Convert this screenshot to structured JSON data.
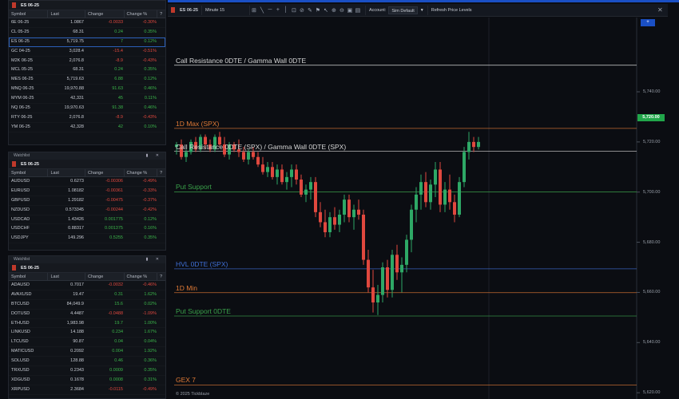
{
  "watchlist1": {
    "symbol": "ES 06-25",
    "headers": [
      "Symbol",
      "Last",
      "Change",
      "Change %"
    ],
    "rows": [
      {
        "sym": "6E 06-25",
        "last": "1.0867",
        "chg": "-0.0033",
        "pct": "-0.30%",
        "dir": "neg"
      },
      {
        "sym": "CL 05-25",
        "last": "68.31",
        "chg": "0.24",
        "pct": "0.35%",
        "dir": "pos"
      },
      {
        "sym": "ES 06-25",
        "last": "5,719.75",
        "chg": "7",
        "pct": "0.12%",
        "dir": "pos"
      },
      {
        "sym": "GC 04-25",
        "last": "3,028.4",
        "chg": "-15.4",
        "pct": "-0.51%",
        "dir": "neg"
      },
      {
        "sym": "M2K 06-25",
        "last": "2,076.8",
        "chg": "-8.9",
        "pct": "-0.43%",
        "dir": "neg"
      },
      {
        "sym": "MCL 05-25",
        "last": "68.31",
        "chg": "0.24",
        "pct": "0.35%",
        "dir": "pos"
      },
      {
        "sym": "MES 06-25",
        "last": "5,719.63",
        "chg": "6.88",
        "pct": "0.12%",
        "dir": "pos"
      },
      {
        "sym": "MNQ 06-25",
        "last": "19,970.88",
        "chg": "91.63",
        "pct": "0.46%",
        "dir": "pos"
      },
      {
        "sym": "MYM 06-25",
        "last": "42,331",
        "chg": "45",
        "pct": "0.11%",
        "dir": "pos"
      },
      {
        "sym": "NQ 06-25",
        "last": "19,970.63",
        "chg": "91.38",
        "pct": "0.46%",
        "dir": "pos"
      },
      {
        "sym": "RTY 06-25",
        "last": "2,076.8",
        "chg": "-8.9",
        "pct": "-0.43%",
        "dir": "neg"
      },
      {
        "sym": "YM 06-25",
        "last": "42,328",
        "chg": "42",
        "pct": "0.10%",
        "dir": "pos"
      }
    ]
  },
  "watchlist2": {
    "title": "Watchlist",
    "symbol": "ES 06-25",
    "headers": [
      "Symbol",
      "Last",
      "Change",
      "Change %"
    ],
    "rows": [
      {
        "sym": "AUDUSD",
        "last": "0.6273",
        "chg": "-0.00306",
        "pct": "-0.49%",
        "dir": "neg"
      },
      {
        "sym": "EURUSD",
        "last": "1.08182",
        "chg": "-0.00361",
        "pct": "-0.33%",
        "dir": "neg"
      },
      {
        "sym": "GBPUSD",
        "last": "1.29182",
        "chg": "-0.00475",
        "pct": "-0.37%",
        "dir": "neg"
      },
      {
        "sym": "NZDUSD",
        "last": "0.573345",
        "chg": "-0.00244",
        "pct": "-0.42%",
        "dir": "neg"
      },
      {
        "sym": "USDCAD",
        "last": "1.43426",
        "chg": "0.001775",
        "pct": "0.12%",
        "dir": "pos"
      },
      {
        "sym": "USDCHF",
        "last": "0.88317",
        "chg": "0.001375",
        "pct": "0.16%",
        "dir": "pos"
      },
      {
        "sym": "USDJPY",
        "last": "149.296",
        "chg": "0.5255",
        "pct": "0.35%",
        "dir": "pos"
      }
    ]
  },
  "watchlist3": {
    "title": "Watchlist",
    "symbol": "ES 06-25",
    "headers": [
      "Symbol",
      "Last",
      "Change",
      "Change %"
    ],
    "rows": [
      {
        "sym": "ADAUSD",
        "last": "0.7017",
        "chg": "-0.0032",
        "pct": "-0.46%",
        "dir": "neg"
      },
      {
        "sym": "AVAXUSD",
        "last": "19.47",
        "chg": "0.31",
        "pct": "1.62%",
        "dir": "pos"
      },
      {
        "sym": "BTCUSD",
        "last": "84,049.9",
        "chg": "15.6",
        "pct": "0.02%",
        "dir": "pos"
      },
      {
        "sym": "DOTUSD",
        "last": "4.4487",
        "chg": "-0.0488",
        "pct": "-1.09%",
        "dir": "neg"
      },
      {
        "sym": "ETHUSD",
        "last": "1,983.98",
        "chg": "19.7",
        "pct": "1.00%",
        "dir": "pos"
      },
      {
        "sym": "LINKUSD",
        "last": "14.188",
        "chg": "0.234",
        "pct": "1.67%",
        "dir": "pos"
      },
      {
        "sym": "LTCUSD",
        "last": "90.87",
        "chg": "0.04",
        "pct": "0.04%",
        "dir": "pos"
      },
      {
        "sym": "MATICUSD",
        "last": "0.2092",
        "chg": "0.004",
        "pct": "1.92%",
        "dir": "pos"
      },
      {
        "sym": "SOLUSD",
        "last": "128.88",
        "chg": "0.46",
        "pct": "0.36%",
        "dir": "pos"
      },
      {
        "sym": "TRXUSD",
        "last": "0.2343",
        "chg": "0.0009",
        "pct": "0.35%",
        "dir": "pos"
      },
      {
        "sym": "XDGUSD",
        "last": "0.1678",
        "chg": "0.0008",
        "pct": "0.31%",
        "dir": "pos"
      },
      {
        "sym": "XRPUSD",
        "last": "2.3684",
        "chg": "-0.0115",
        "pct": "-0.49%",
        "dir": "neg"
      }
    ]
  },
  "toolbar": {
    "tab": "ES 06-25",
    "interval": "Minute 15",
    "account_label": "Account:",
    "account_value": "Sim Default",
    "refresh": "Refresh Price Levels",
    "close": "✕"
  },
  "chart": {
    "last_price": "5,720.00",
    "plus_button": "+",
    "copyright": "© 2025 Tickblaze",
    "axis_ticks": [
      {
        "label": "5,740.00",
        "value": 5740
      },
      {
        "label": "5,720.00",
        "value": 5720
      },
      {
        "label": "5,700.00",
        "value": 5700
      },
      {
        "label": "5,680.00",
        "value": 5680
      },
      {
        "label": "5,660.00",
        "value": 5660
      },
      {
        "label": "5,640.00",
        "value": 5640
      },
      {
        "label": "5,620.00",
        "value": 5620
      }
    ],
    "levels": [
      {
        "name": "Call Resistance 0DTE / Gamma Wall 0DTE",
        "value": 5750.6,
        "color": "#d6d6d6"
      },
      {
        "name": "1D Max (SPX)",
        "value": 5725.4,
        "color": "#e07a36"
      },
      {
        "name": "Call Resistance 0DTE (SPX) / Gamma Wall 0DTE (SPX)",
        "value": 5716.3,
        "color": "#d6d6d6"
      },
      {
        "name": "Put Support",
        "value": 5700.1,
        "color": "#3aa14a"
      },
      {
        "name": "HVL 0DTE (SPX)",
        "value": 5669.4,
        "color": "#3f6fd6"
      },
      {
        "name": "1D Min",
        "value": 5659.9,
        "color": "#e07a36"
      },
      {
        "name": "Put Support 0DTE",
        "value": 5650.6,
        "color": "#3aa14a"
      },
      {
        "name": "GEX 7",
        "value": 5623.1,
        "color": "#e07a36"
      }
    ]
  },
  "chart_data": {
    "type": "candlestick",
    "ylim": [
      5617.5,
      5769.6
    ],
    "candles": [
      [
        5718,
        5720,
        5715,
        5719
      ],
      [
        5719,
        5721,
        5713,
        5714
      ],
      [
        5714,
        5717,
        5712,
        5716
      ],
      [
        5716,
        5721,
        5715,
        5720
      ],
      [
        5720,
        5722,
        5716,
        5717
      ],
      [
        5717,
        5723,
        5716,
        5722
      ],
      [
        5722,
        5723,
        5717,
        5719
      ],
      [
        5719,
        5721,
        5716,
        5717
      ],
      [
        5717,
        5723,
        5716,
        5722
      ],
      [
        5722,
        5724,
        5718,
        5719
      ],
      [
        5719,
        5722,
        5714,
        5715
      ],
      [
        5715,
        5720,
        5713,
        5719
      ],
      [
        5719,
        5720,
        5716,
        5717
      ],
      [
        5717,
        5721,
        5714,
        5716
      ],
      [
        5716,
        5718,
        5712,
        5713
      ],
      [
        5713,
        5717,
        5711,
        5716
      ],
      [
        5716,
        5718,
        5713,
        5714
      ],
      [
        5714,
        5716,
        5710,
        5711
      ],
      [
        5711,
        5714,
        5707,
        5708
      ],
      [
        5708,
        5712,
        5706,
        5710
      ],
      [
        5710,
        5712,
        5705,
        5706
      ],
      [
        5706,
        5711,
        5703,
        5709
      ],
      [
        5709,
        5711,
        5703,
        5704
      ],
      [
        5704,
        5708,
        5701,
        5706
      ],
      [
        5706,
        5711,
        5702,
        5709
      ],
      [
        5709,
        5711,
        5703,
        5705
      ],
      [
        5705,
        5707,
        5698,
        5699
      ],
      [
        5699,
        5703,
        5696,
        5701
      ],
      [
        5701,
        5706,
        5697,
        5704
      ],
      [
        5704,
        5706,
        5690,
        5692
      ],
      [
        5692,
        5696,
        5686,
        5688
      ],
      [
        5688,
        5693,
        5682,
        5684
      ],
      [
        5684,
        5692,
        5682,
        5690
      ],
      [
        5690,
        5694,
        5685,
        5687
      ],
      [
        5687,
        5693,
        5684,
        5691
      ],
      [
        5691,
        5699,
        5688,
        5697
      ],
      [
        5697,
        5699,
        5688,
        5690
      ],
      [
        5690,
        5695,
        5685,
        5693
      ],
      [
        5693,
        5697,
        5689,
        5691
      ],
      [
        5691,
        5693,
        5671,
        5673
      ],
      [
        5673,
        5677,
        5660,
        5662
      ],
      [
        5662,
        5669,
        5652,
        5656
      ],
      [
        5656,
        5663,
        5651,
        5659
      ],
      [
        5659,
        5672,
        5656,
        5670
      ],
      [
        5670,
        5673,
        5658,
        5661
      ],
      [
        5661,
        5677,
        5658,
        5675
      ],
      [
        5675,
        5679,
        5665,
        5668
      ],
      [
        5668,
        5674,
        5660,
        5671
      ],
      [
        5671,
        5683,
        5668,
        5681
      ],
      [
        5681,
        5695,
        5676,
        5693
      ],
      [
        5693,
        5702,
        5688,
        5699
      ],
      [
        5699,
        5707,
        5693,
        5704
      ],
      [
        5704,
        5708,
        5694,
        5696
      ],
      [
        5696,
        5705,
        5693,
        5703
      ],
      [
        5703,
        5712,
        5698,
        5709
      ],
      [
        5709,
        5712,
        5692,
        5695
      ],
      [
        5695,
        5704,
        5692,
        5701
      ],
      [
        5701,
        5707,
        5693,
        5696
      ],
      [
        5696,
        5699,
        5688,
        5691
      ],
      [
        5691,
        5706,
        5690,
        5704
      ],
      [
        5704,
        5718,
        5702,
        5716
      ],
      [
        5716,
        5724,
        5713,
        5720
      ],
      [
        5720,
        5722,
        5716,
        5718
      ],
      [
        5718,
        5722,
        5717,
        5720
      ]
    ]
  },
  "colors": {
    "up": "#2ea866",
    "down": "#e0483e",
    "accent": "#1a4fc4"
  }
}
